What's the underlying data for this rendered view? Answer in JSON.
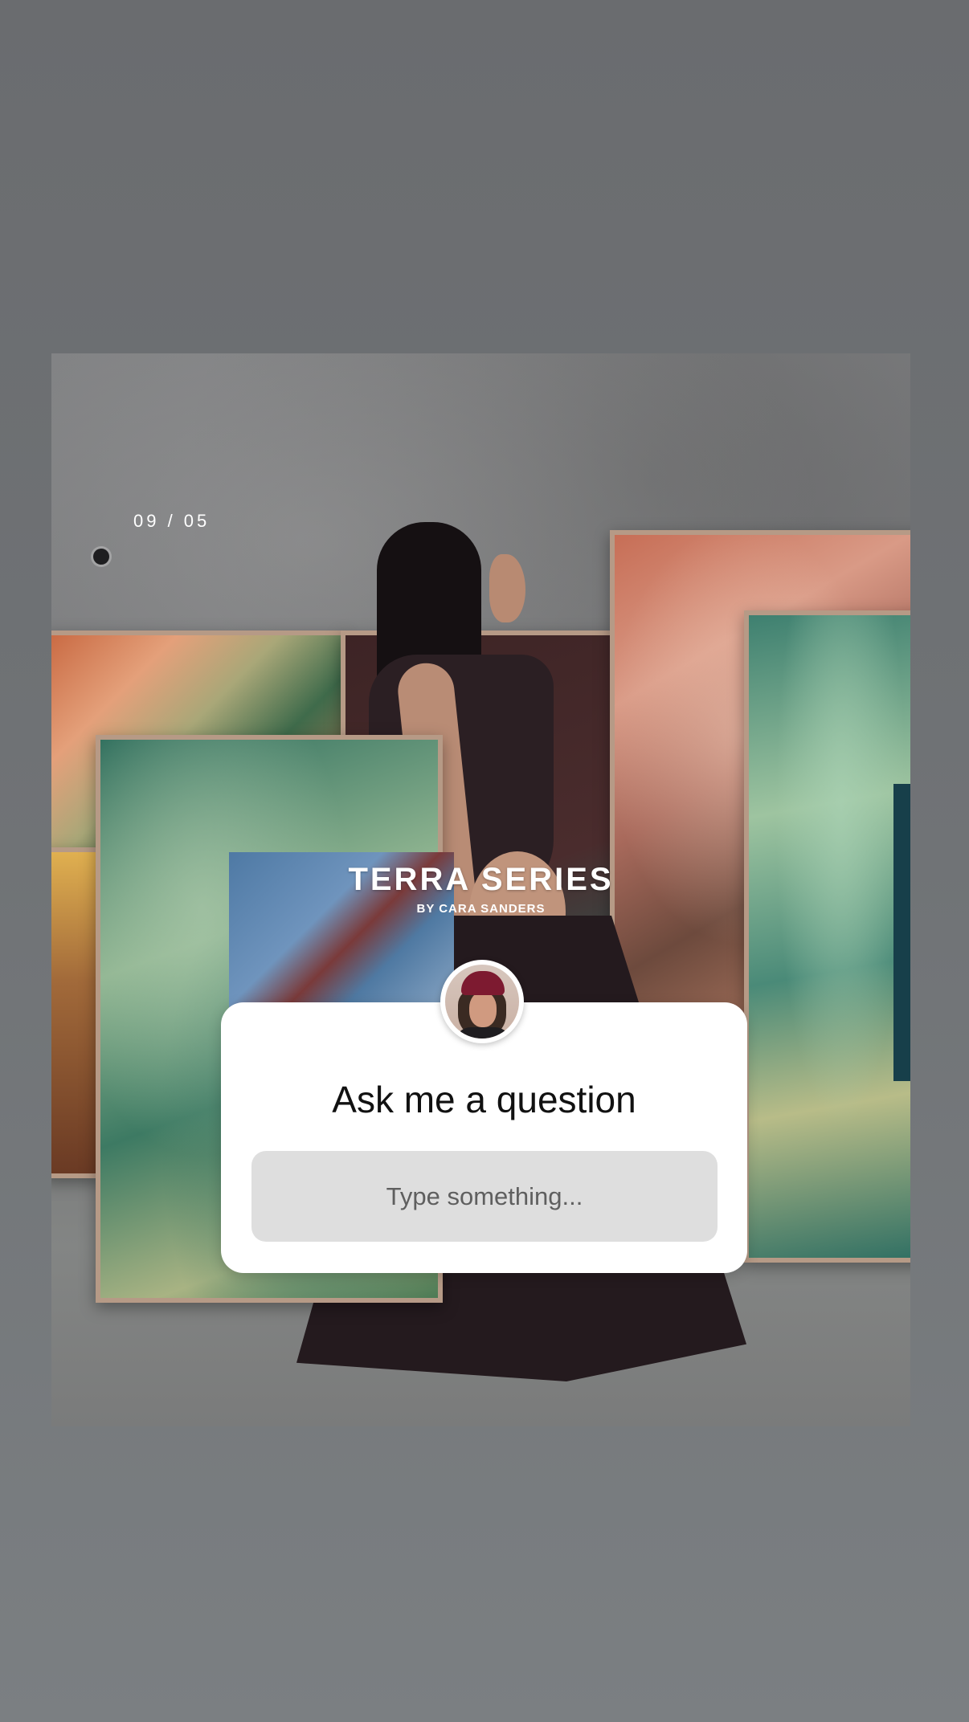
{
  "story": {
    "counter": "09 / 05",
    "title": "TERRA SERIES",
    "subtitle": "BY CARA SANDERS"
  },
  "question_sticker": {
    "prompt": "Ask me a question",
    "placeholder": "Type something..."
  },
  "icons": {
    "camera": "camera-icon",
    "avatar": "avatar"
  }
}
